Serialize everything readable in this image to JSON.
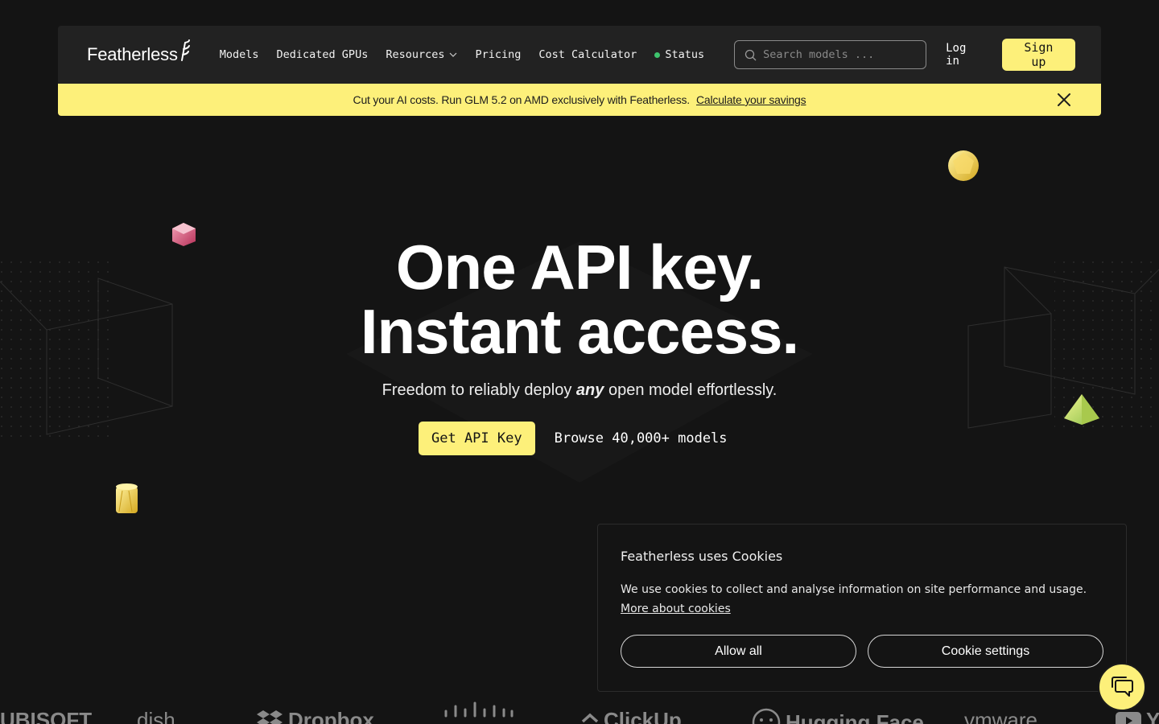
{
  "header": {
    "logo_text": "Featherless",
    "nav": [
      {
        "label": "Models"
      },
      {
        "label": "Dedicated GPUs"
      },
      {
        "label": "Resources"
      },
      {
        "label": "Pricing"
      },
      {
        "label": "Cost Calculator"
      },
      {
        "label": "Status"
      }
    ],
    "search_placeholder": "Search models ...",
    "login_label": "Log in",
    "signup_label": "Sign up"
  },
  "banner": {
    "text": "Cut your AI costs. Run GLM 5.2 on AMD exclusively with Featherless.",
    "link": "Calculate your savings"
  },
  "hero": {
    "title_line1": "One API key.",
    "title_line2": "Instant access.",
    "subtitle_before": "Freedom to reliably deploy",
    "subtitle_emph": "any",
    "subtitle_after": "open model effortlessly.",
    "cta_primary": "Get API Key",
    "cta_secondary": "Browse 40,000+ models"
  },
  "cookie": {
    "title": "Featherless uses Cookies",
    "body": "We use cookies to collect and analyse information on site performance and usage.",
    "link": "More about cookies",
    "allow_label": "Allow all",
    "settings_label": "Cookie settings"
  },
  "logos": [
    "UBISOFT",
    "dish",
    "Dropbox",
    "cisco",
    "ClickUp",
    "Hugging Face",
    "vmware",
    "YouTube"
  ],
  "colors": {
    "background": "#141414",
    "header": "#222222",
    "accent": "#fdf07a",
    "status": "#3ec46d"
  }
}
